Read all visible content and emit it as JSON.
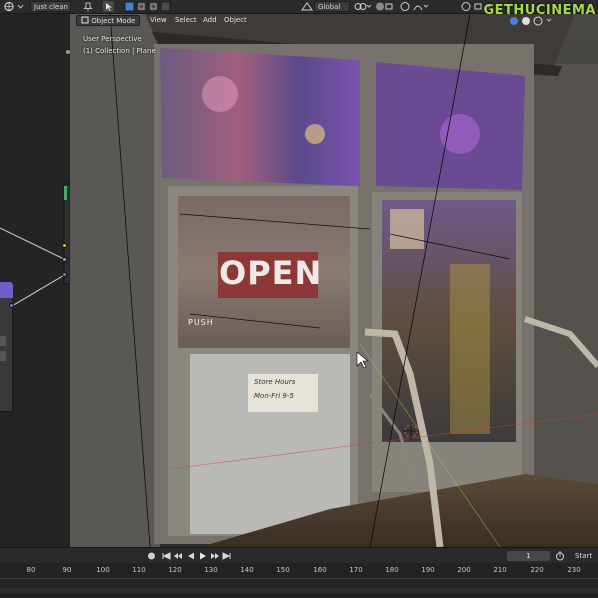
{
  "topbar": {
    "file_field": "Just clean c",
    "transform_orientation": "Global"
  },
  "viewport_header": {
    "mode": "Object Mode",
    "menu": [
      "View",
      "Select",
      "Add",
      "Object"
    ]
  },
  "viewport_overlay": {
    "perspective": "User Perspective",
    "collection": "(1) Collection | Plane"
  },
  "scene_text": {
    "open_sign": "OPEN",
    "push_label": "PUSH",
    "hours_line1": "Store Hours",
    "hours_line2": "Mon-Fri 9-5"
  },
  "timeline": {
    "current_frame": "1",
    "start_label": "Start",
    "ticks": [
      "80",
      "90",
      "100",
      "110",
      "120",
      "130",
      "140",
      "150",
      "160",
      "170",
      "180",
      "190",
      "200",
      "210",
      "220",
      "230"
    ]
  },
  "watermark": "GETHUCINEMA",
  "colors": {
    "node_header": "#6c5fc8",
    "socket_yellow": "#d9c43a",
    "socket_blue": "#6f7fd0",
    "socket_green": "#3fae6c"
  }
}
